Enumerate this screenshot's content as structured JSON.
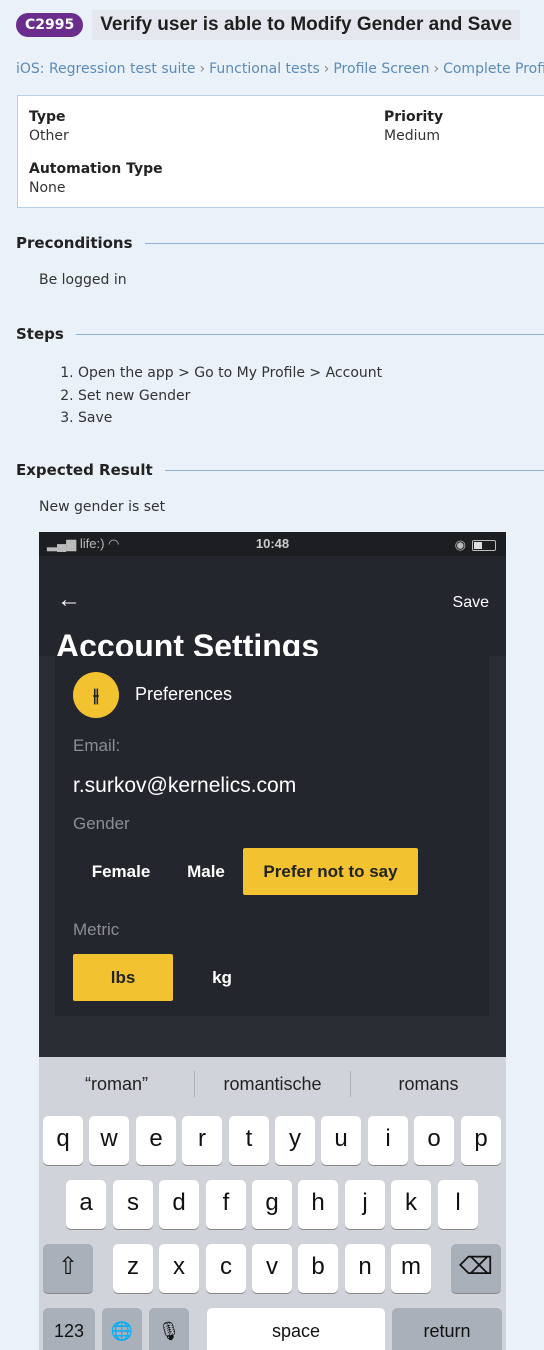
{
  "header": {
    "case_id": "C2995",
    "title": "Verify user is able to Modify Gender and Save"
  },
  "breadcrumb": [
    "iOS: Regression test suite",
    "Functional tests",
    "Profile Screen",
    "Complete Profile"
  ],
  "props": {
    "type_label": "Type",
    "type_value": "Other",
    "priority_label": "Priority",
    "priority_value": "Medium",
    "automation_label": "Automation Type",
    "automation_value": "None"
  },
  "preconditions": {
    "heading": "Preconditions",
    "text": "Be logged in"
  },
  "steps": {
    "heading": "Steps",
    "items": [
      "Open the app > Go to My Profile > Account",
      "Set new Gender",
      "Save"
    ]
  },
  "expected": {
    "heading": "Expected Result",
    "text": "New gender is set"
  },
  "phone": {
    "status": {
      "carrier": "life:)",
      "time": "10:48"
    },
    "nav": {
      "back_icon": "arrow-left-icon",
      "save": "Save",
      "title": "Account Settings"
    },
    "preferences": "Preferences",
    "email_label": "Email:",
    "email": "r.surkov@kernelics.com",
    "gender_label": "Gender",
    "gender_options": [
      "Female",
      "Male",
      "Prefer not to say"
    ],
    "gender_selected": "Prefer not to say",
    "metric_label": "Metric",
    "metric_options": [
      "lbs",
      "kg"
    ],
    "metric_selected": "lbs",
    "suggestions": [
      "“roman”",
      "romantische",
      "romans"
    ],
    "keys": {
      "row1": [
        "q",
        "w",
        "e",
        "r",
        "t",
        "y",
        "u",
        "i",
        "o",
        "p"
      ],
      "row2": [
        "a",
        "s",
        "d",
        "f",
        "g",
        "h",
        "j",
        "k",
        "l"
      ],
      "row3": [
        "z",
        "x",
        "c",
        "v",
        "b",
        "n",
        "m"
      ],
      "num": "123",
      "space": "space",
      "return": "return"
    },
    "colors": {
      "accent": "#f2c230",
      "background": "#2a2d34"
    }
  }
}
